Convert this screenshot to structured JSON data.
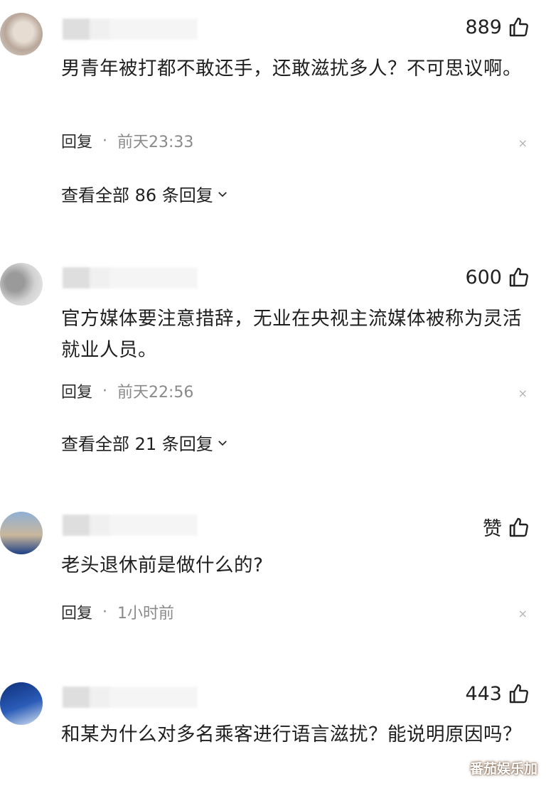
{
  "comments": [
    {
      "likes": "889",
      "text": "男青年被打都不敢还手，还敢滋扰多人？不可思议啊。",
      "reply_label": "回复",
      "dot": "·",
      "time": "前天23:33",
      "close": "×",
      "view_replies": "查看全部 86 条回复"
    },
    {
      "likes": "600",
      "text": "官方媒体要注意措辞，无业在央视主流媒体被称为灵活就业人员。",
      "reply_label": "回复",
      "dot": "·",
      "time": "前天22:56",
      "close": "×",
      "view_replies": "查看全部 21 条回复"
    },
    {
      "likes": "赞",
      "text": "老头退休前是做什么的?",
      "reply_label": "回复",
      "dot": "·",
      "time": "1小时前",
      "close": "×"
    },
    {
      "likes": "443",
      "text": "和某为什么对多名乘客进行语言滋扰？能说明原因吗？"
    }
  ],
  "watermark": "番茄娱乐加",
  "colors": {
    "text": "#1f1f1f",
    "meta": "#8a8a8a",
    "close": "#b3b3b3"
  },
  "icons": {
    "like": "thumbs-up-icon",
    "chevron": "chevron-down-icon",
    "close": "close-icon"
  }
}
